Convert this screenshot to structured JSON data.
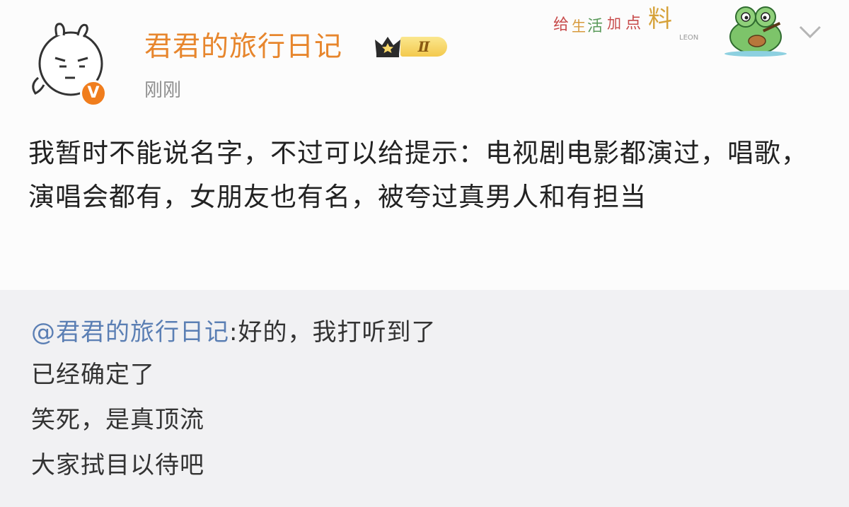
{
  "post": {
    "username": "君君的旅行日记",
    "level": "Ⅱ",
    "verified_mark": "V",
    "time": "刚刚",
    "body": "我暂时不能说名字，不过可以给提示：电视剧电影都演过，唱歌，演唱会都有，女朋友也有名，被夸过真男人和有担当",
    "decoration": {
      "sticker_text": "给生活加点料",
      "sticker_sub": "LEON"
    }
  },
  "repost": {
    "mention": "@君君的旅行日记",
    "line1_rest": ":好的，我打听到了",
    "line2": "已经确定了",
    "line3": "笑死，是真顶流",
    "line4": "大家拭目以待吧"
  },
  "colors": {
    "username": "#e7862d",
    "mention": "#5b7fb4",
    "verified": "#f07d1d"
  },
  "icons": [
    "cartoon-avatar",
    "crown-icon",
    "frog-guitar-sticker",
    "chevron-down-icon"
  ]
}
